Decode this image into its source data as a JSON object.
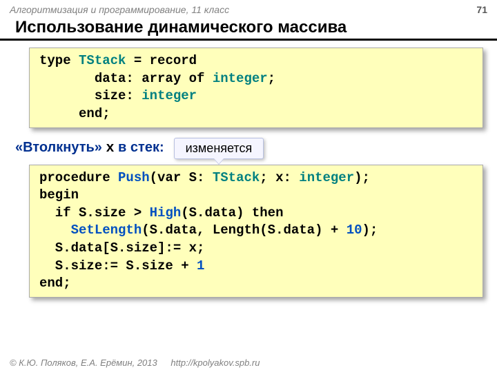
{
  "header": {
    "course": "Алгоритмизация и программирование, 11 класс",
    "page": "71"
  },
  "title": "Использование динамического массива",
  "code1": {
    "l1a": "type ",
    "l1b": "TStack",
    "l1c": " = record",
    "l2a": "       data: array of ",
    "l2b": "integer",
    "l2c": ";",
    "l3a": "       size: ",
    "l3b": "integer",
    "l4": "     end;"
  },
  "subhead": {
    "pre": "«Втолкнуть» ",
    "var": "x",
    "post": " в стек:"
  },
  "callout": "изменяется",
  "code2": {
    "l1a": "procedure ",
    "l1b": "Push",
    "l1c": "(var S: ",
    "l1d": "TStack",
    "l1e": "; x: ",
    "l1f": "integer",
    "l1g": ");",
    "l2": "begin",
    "l3a": "  if S.size > ",
    "l3b": "High",
    "l3c": "(S.data) then",
    "l4a": "    ",
    "l4b": "SetLength",
    "l4c": "(S.data, Length(S.data) + ",
    "l4d": "10",
    "l4e": ");",
    "l5": "  S.data[S.size]:= x;",
    "l6a": "  S.size:= S.size + ",
    "l6b": "1",
    "l7": "end;"
  },
  "footer": {
    "copyright": "© К.Ю. Поляков, Е.А. Ерёмин, 2013",
    "url": "http://kpolyakov.spb.ru"
  }
}
